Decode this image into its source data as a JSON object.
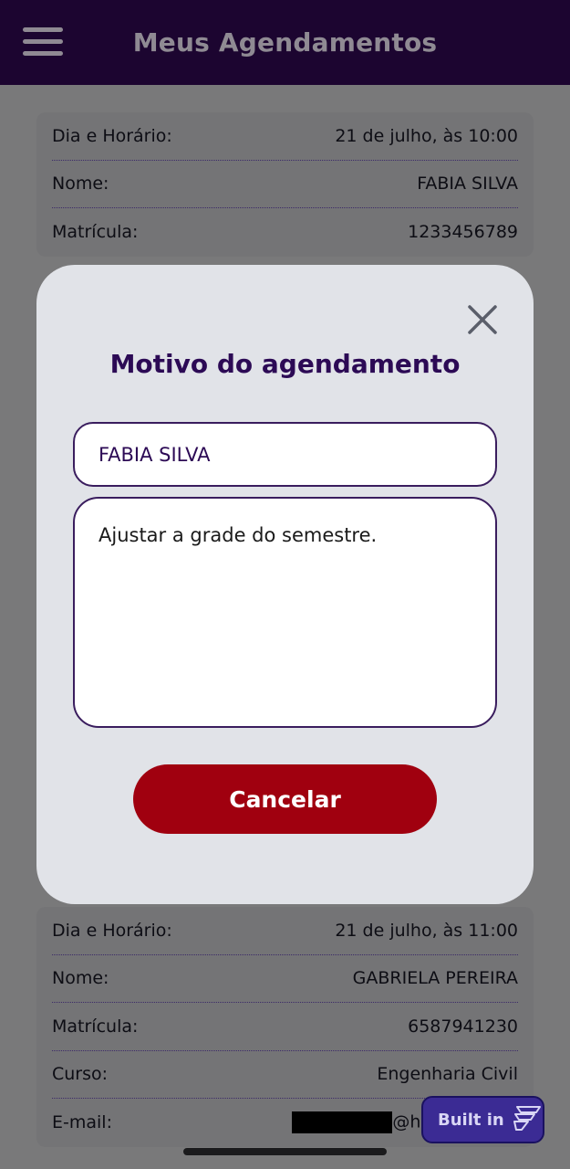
{
  "header": {
    "title": "Meus Agendamentos"
  },
  "cards": [
    {
      "rows": [
        {
          "label": "Dia e Horário:",
          "value": "21 de julho, às 10:00"
        },
        {
          "label": "Nome:",
          "value": "FABIA SILVA"
        },
        {
          "label": "Matrícula:",
          "value": "1233456789"
        }
      ]
    },
    {
      "rows": [
        {
          "label": "Dia e Horário:",
          "value": "21 de julho, às 11:00"
        },
        {
          "label": "Nome:",
          "value": "GABRIELA PEREIRA"
        },
        {
          "label": "Matrícula:",
          "value": "6587941230"
        },
        {
          "label": "Curso:",
          "value": "Engenharia Civil"
        },
        {
          "label": "E-mail:",
          "value_suffix": "@ho"
        }
      ]
    }
  ],
  "modal": {
    "title": "Motivo do agendamento",
    "name_field": "FABIA SILVA",
    "reason_field": "Ajustar a grade do semestre.",
    "cancel_label": "Cancelar"
  },
  "badge": {
    "label": "Built in"
  },
  "colors": {
    "header_bg": "#1c0530",
    "modal_title": "#2c0a55",
    "cancel_bg": "#a0000f",
    "badge_bg": "#3b2b94"
  },
  "icons": {
    "menu": "hamburger-menu-icon",
    "close": "close-icon",
    "builder": "builder-logo-icon"
  }
}
